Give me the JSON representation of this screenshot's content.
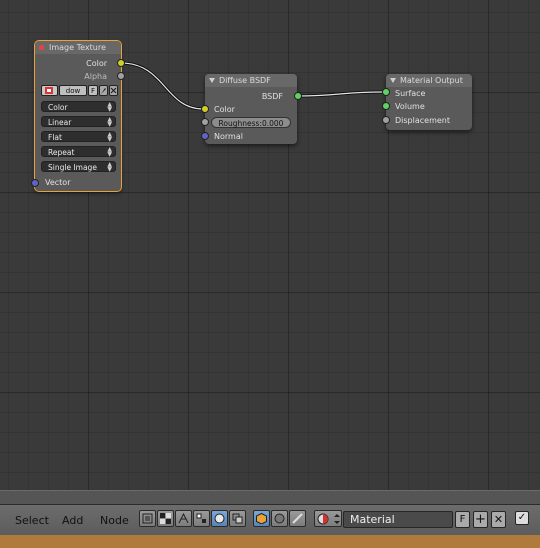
{
  "nodes": {
    "image_texture": {
      "title": "Image Texture",
      "outputs": [
        "Color",
        "Alpha"
      ],
      "image_name": "dow",
      "image_f": "F",
      "dropdowns": [
        "Color",
        "Linear",
        "Flat",
        "Repeat",
        "Single Image"
      ],
      "input": "Vector"
    },
    "diffuse": {
      "title": "Diffuse BSDF",
      "output": "BSDF",
      "inputs": {
        "color": "Color",
        "roughness": "Roughness:",
        "roughness_value": "0.000",
        "normal": "Normal"
      }
    },
    "material_output": {
      "title": "Material Output",
      "inputs": [
        "Surface",
        "Volume",
        "Displacement"
      ]
    }
  },
  "header": {
    "menus": [
      "Select",
      "Add",
      "Node"
    ],
    "material_name": "Material",
    "fake_user": "F",
    "use_nodes_check": "✓"
  },
  "socket_colors": {
    "color": "#cfcf29",
    "float": "#a0a0a0",
    "shader": "#5fd35f",
    "vector": "#6363c7"
  },
  "icons": [
    "render-layer-icon",
    "texture-checker-icon",
    "compositing-icon",
    "texture-icon",
    "shader-sphere-icon",
    "snap-icon",
    "object-cube-icon",
    "world-icon",
    "line-style-icon",
    "material-browse-icon",
    "new-material-icon",
    "unlink-icon"
  ]
}
